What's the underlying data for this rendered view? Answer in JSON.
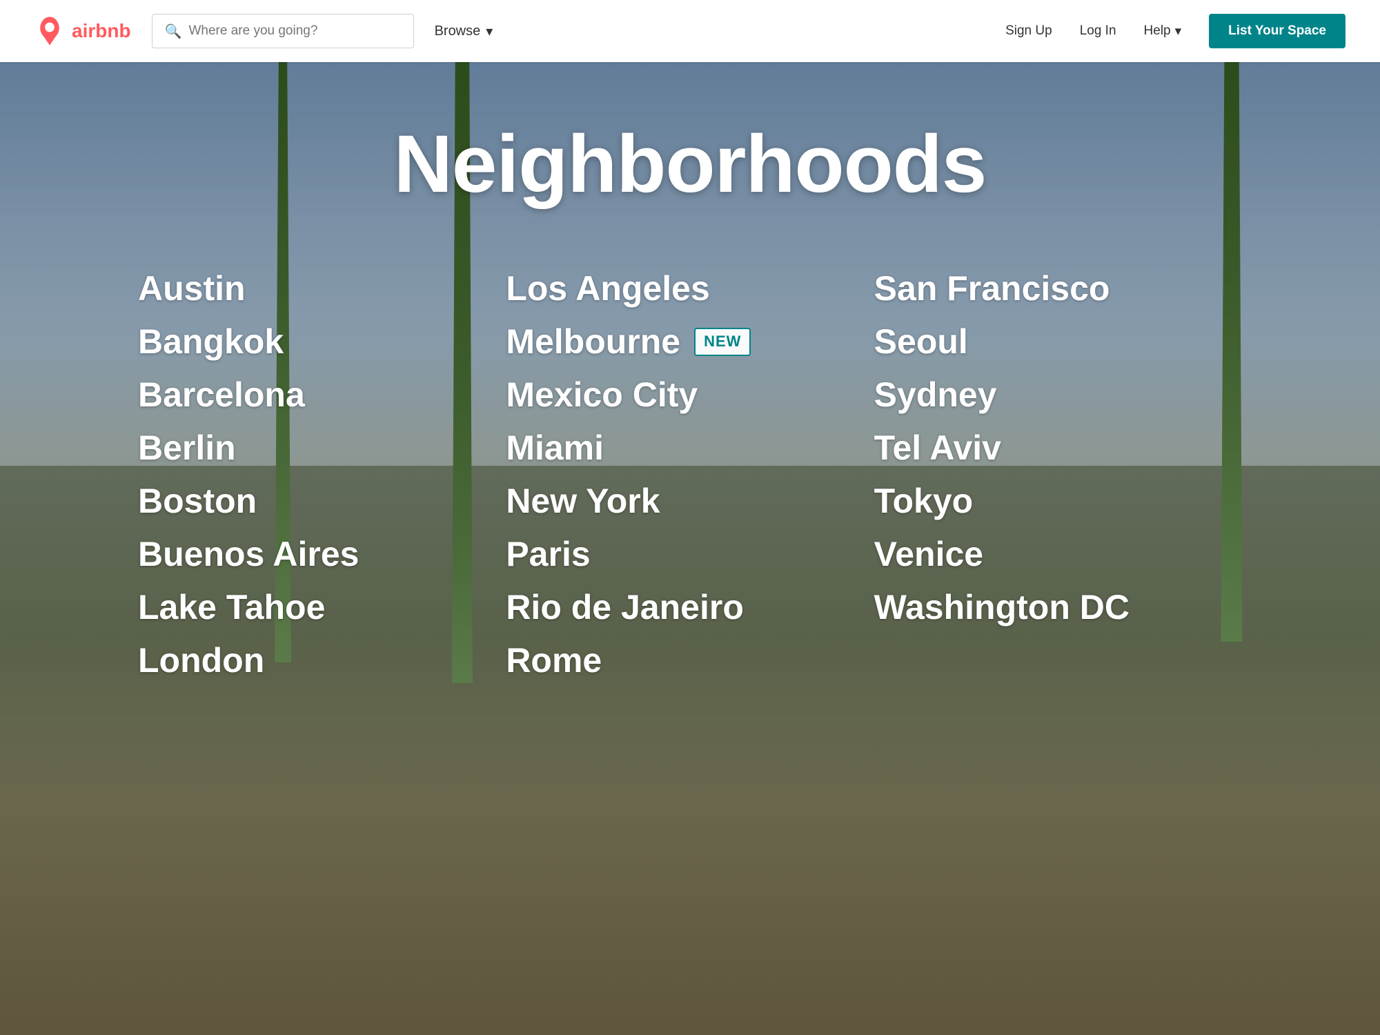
{
  "navbar": {
    "logo_text": "airbnb",
    "search_placeholder": "Where are you going?",
    "browse_label": "Browse",
    "signup_label": "Sign Up",
    "login_label": "Log In",
    "help_label": "Help",
    "list_space_label": "List Your Space"
  },
  "page": {
    "title": "Neighborhoods"
  },
  "cities": {
    "column1": [
      {
        "name": "Austin",
        "new": false
      },
      {
        "name": "Bangkok",
        "new": false
      },
      {
        "name": "Barcelona",
        "new": false
      },
      {
        "name": "Berlin",
        "new": false
      },
      {
        "name": "Boston",
        "new": false
      },
      {
        "name": "Buenos Aires",
        "new": false
      },
      {
        "name": "Lake Tahoe",
        "new": false
      },
      {
        "name": "London",
        "new": false
      }
    ],
    "column2": [
      {
        "name": "Los Angeles",
        "new": false
      },
      {
        "name": "Melbourne",
        "new": true,
        "badge": "NEW"
      },
      {
        "name": "Mexico City",
        "new": false
      },
      {
        "name": "Miami",
        "new": false
      },
      {
        "name": "New York",
        "new": false
      },
      {
        "name": "Paris",
        "new": false
      },
      {
        "name": "Rio de Janeiro",
        "new": false
      },
      {
        "name": "Rome",
        "new": false
      }
    ],
    "column3": [
      {
        "name": "San Francisco",
        "new": false
      },
      {
        "name": "Seoul",
        "new": false
      },
      {
        "name": "Sydney",
        "new": false
      },
      {
        "name": "Tel Aviv",
        "new": false
      },
      {
        "name": "Tokyo",
        "new": false
      },
      {
        "name": "Venice",
        "new": false
      },
      {
        "name": "Washington DC",
        "new": false
      }
    ]
  },
  "colors": {
    "primary": "#FF5A5F",
    "teal": "#008489",
    "white": "#ffffff"
  }
}
